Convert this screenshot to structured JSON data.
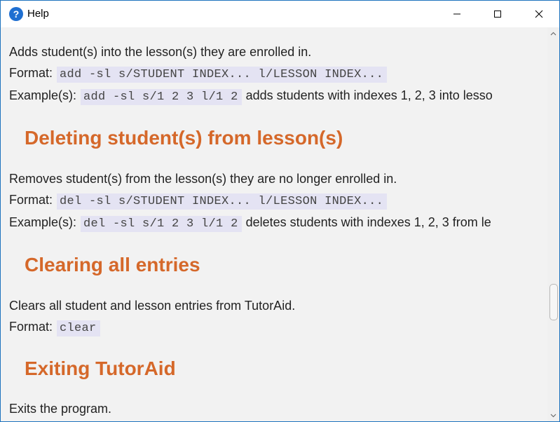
{
  "window": {
    "title": "Help",
    "icon": "help-question-icon"
  },
  "sections": {
    "add_lesson": {
      "description": "Adds student(s) into the lesson(s) they are enrolled in.",
      "format_label": "Format:",
      "format_code": "add -sl s/STUDENT INDEX... l/LESSON INDEX...",
      "example_label": "Example(s):",
      "example_code": "add -sl s/1 2 3 l/1 2",
      "example_text": "adds students with indexes 1, 2, 3 into lesso"
    },
    "delete_lesson": {
      "heading": "Deleting student(s) from lesson(s)",
      "description": "Removes student(s) from the lesson(s) they are no longer enrolled in.",
      "format_label": "Format:",
      "format_code": "del -sl s/STUDENT INDEX... l/LESSON INDEX...",
      "example_label": "Example(s):",
      "example_code": "del -sl s/1 2 3 l/1 2",
      "example_text": "deletes students with indexes 1, 2, 3 from le"
    },
    "clear": {
      "heading": "Clearing all entries",
      "description": "Clears all student and lesson entries from TutorAid.",
      "format_label": "Format:",
      "format_code": "clear"
    },
    "exit": {
      "heading": "Exiting TutorAid",
      "description": "Exits the program."
    }
  },
  "colors": {
    "heading": "#d5682a",
    "code_bg": "#e4e3f3",
    "content_bg": "#f2f2f2"
  }
}
